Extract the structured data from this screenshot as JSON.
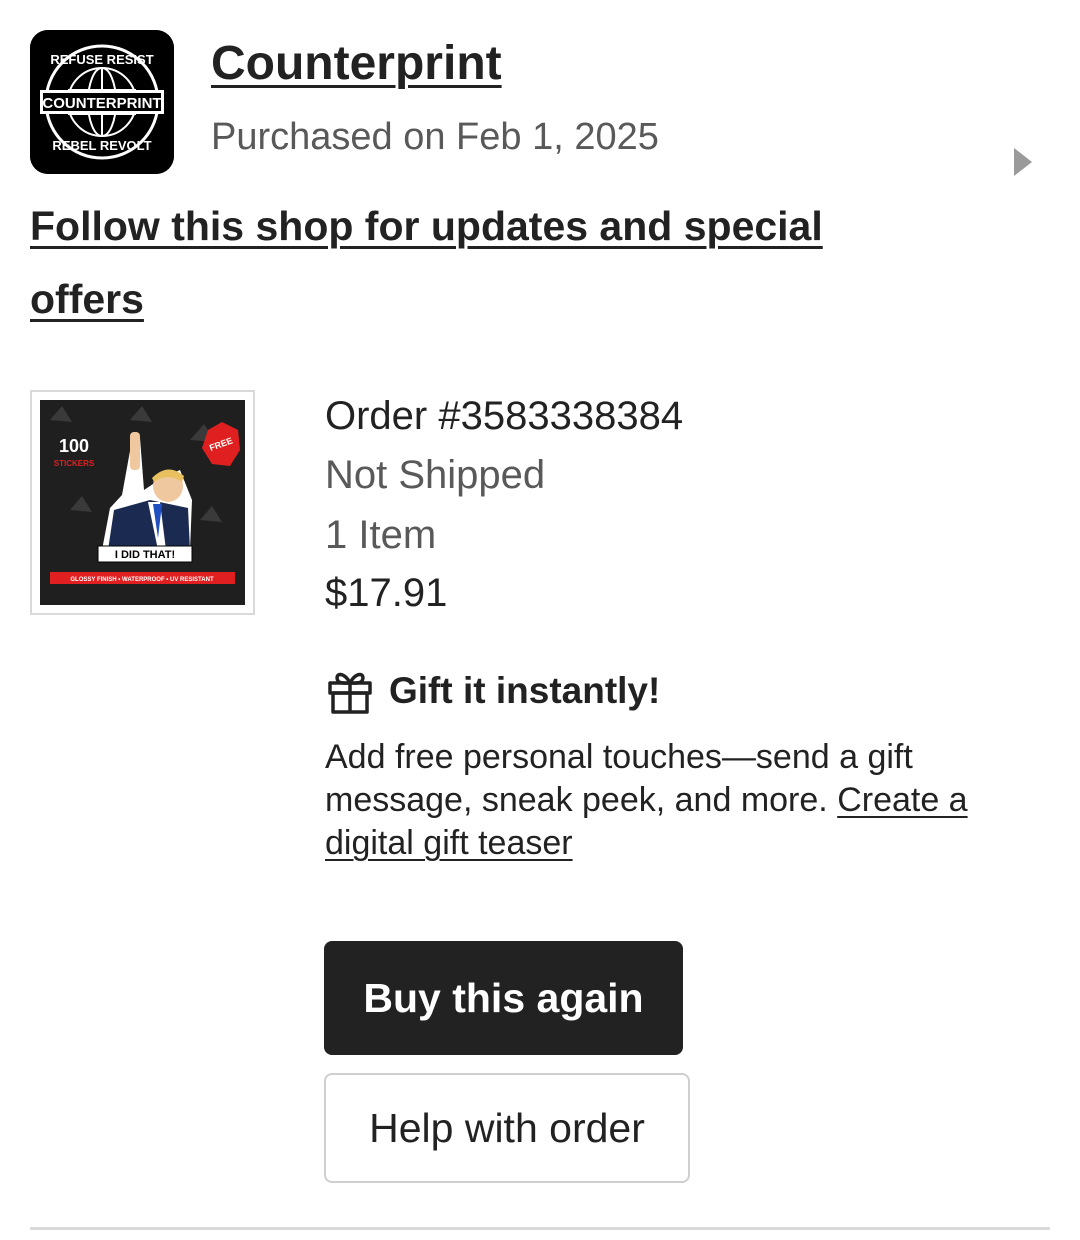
{
  "shop": {
    "name": "Counterprint",
    "purchase_date": "Purchased on Feb 1, 2025",
    "follow_text": "Follow this shop for updates and special offers",
    "logo": {
      "center_text": "COUNTERPRINT",
      "top_text": "REFUSE RESIST",
      "bottom_text": "REBEL REVOLT"
    }
  },
  "product": {
    "thumbnail": {
      "badge_count": "100",
      "badge_label": "STICKERS",
      "corner_badge": "FREE",
      "caption": "I DID THAT!",
      "footer_text": "GLOSSY FINISH • WATERPROOF • UV RESISTANT"
    }
  },
  "order": {
    "number": "Order #3583338384",
    "status": "Not Shipped",
    "item_count": "1 Item",
    "price": "$17.91"
  },
  "gift": {
    "icon": "gift-icon",
    "title": "Gift it instantly!",
    "description": "Add free personal touches—send a gift message, sneak peek, and more.",
    "link_text": "Create a digital gift teaser"
  },
  "actions": {
    "buy_again": "Buy this again",
    "help": "Help with order"
  },
  "colors": {
    "primary_button_bg": "#222222",
    "text": "#222222",
    "muted_text": "#595959",
    "border": "#d9d9d9"
  }
}
